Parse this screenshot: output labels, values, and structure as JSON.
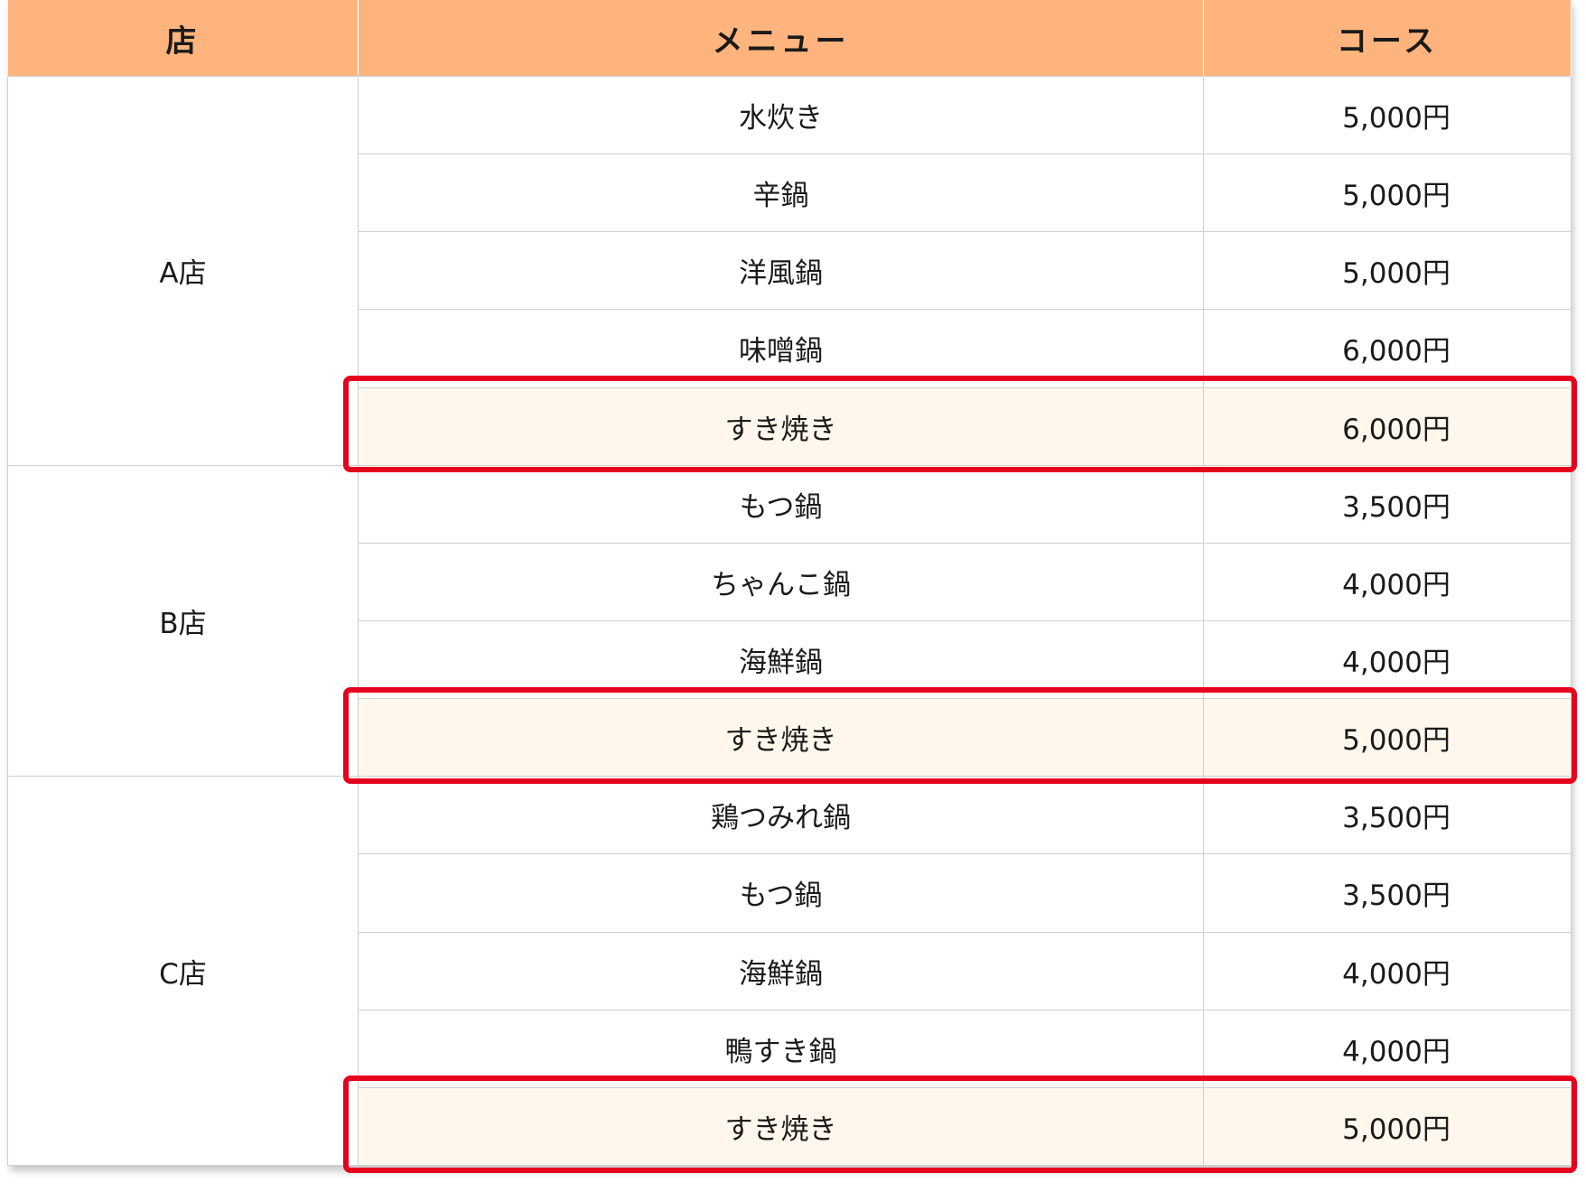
{
  "colors": {
    "header_bg": "#ffb47e",
    "highlight_bg": "#fff7ec",
    "highlight_border": "#e5001e",
    "grid": "#cfcfcf"
  },
  "headers": {
    "store": "店",
    "menu": "メニュー",
    "course": "コース"
  },
  "stores": [
    {
      "name": "A店",
      "rows": [
        {
          "menu": "水炊き",
          "course": "5,000円",
          "highlight": false
        },
        {
          "menu": "辛鍋",
          "course": "5,000円",
          "highlight": false
        },
        {
          "menu": "洋風鍋",
          "course": "5,000円",
          "highlight": false
        },
        {
          "menu": "味噌鍋",
          "course": "6,000円",
          "highlight": false
        },
        {
          "menu": "すき焼き",
          "course": "6,000円",
          "highlight": true
        }
      ]
    },
    {
      "name": "B店",
      "rows": [
        {
          "menu": "もつ鍋",
          "course": "3,500円",
          "highlight": false
        },
        {
          "menu": "ちゃんこ鍋",
          "course": "4,000円",
          "highlight": false
        },
        {
          "menu": "海鮮鍋",
          "course": "4,000円",
          "highlight": false
        },
        {
          "menu": "すき焼き",
          "course": "5,000円",
          "highlight": true
        }
      ]
    },
    {
      "name": "C店",
      "rows": [
        {
          "menu": "鶏つみれ鍋",
          "course": "3,500円",
          "highlight": false
        },
        {
          "menu": "もつ鍋",
          "course": "3,500円",
          "highlight": false
        },
        {
          "menu": "海鮮鍋",
          "course": "4,000円",
          "highlight": false
        },
        {
          "menu": "鴨すき鍋",
          "course": "4,000円",
          "highlight": false
        },
        {
          "menu": "すき焼き",
          "course": "5,000円",
          "highlight": true
        }
      ]
    }
  ]
}
